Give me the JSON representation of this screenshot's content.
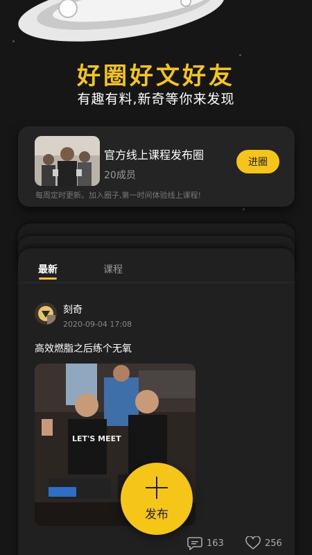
{
  "hero": {
    "title": "好圈好文好友",
    "subtitle": "有趣有料,新奇等你来发现"
  },
  "circle": {
    "name": "官方线上课程发布圈",
    "members": "20成员",
    "join_label": "进圈",
    "description": "每周定时更新。加入圈子,第一时间体验线上课程!"
  },
  "tabs": [
    {
      "label": "最新",
      "active": true
    },
    {
      "label": "课程",
      "active": false
    }
  ],
  "post": {
    "author": "刻奇",
    "time": "2020-09-04 17:08",
    "text": "高效燃脂之后练个无氧",
    "shirt_text": "LET'S MEET",
    "comments": "163",
    "likes": "256"
  },
  "fab": {
    "label": "发布",
    "icon": "plus-icon"
  },
  "colors": {
    "accent": "#F5C518",
    "background": "#161616",
    "card": "#242424"
  }
}
